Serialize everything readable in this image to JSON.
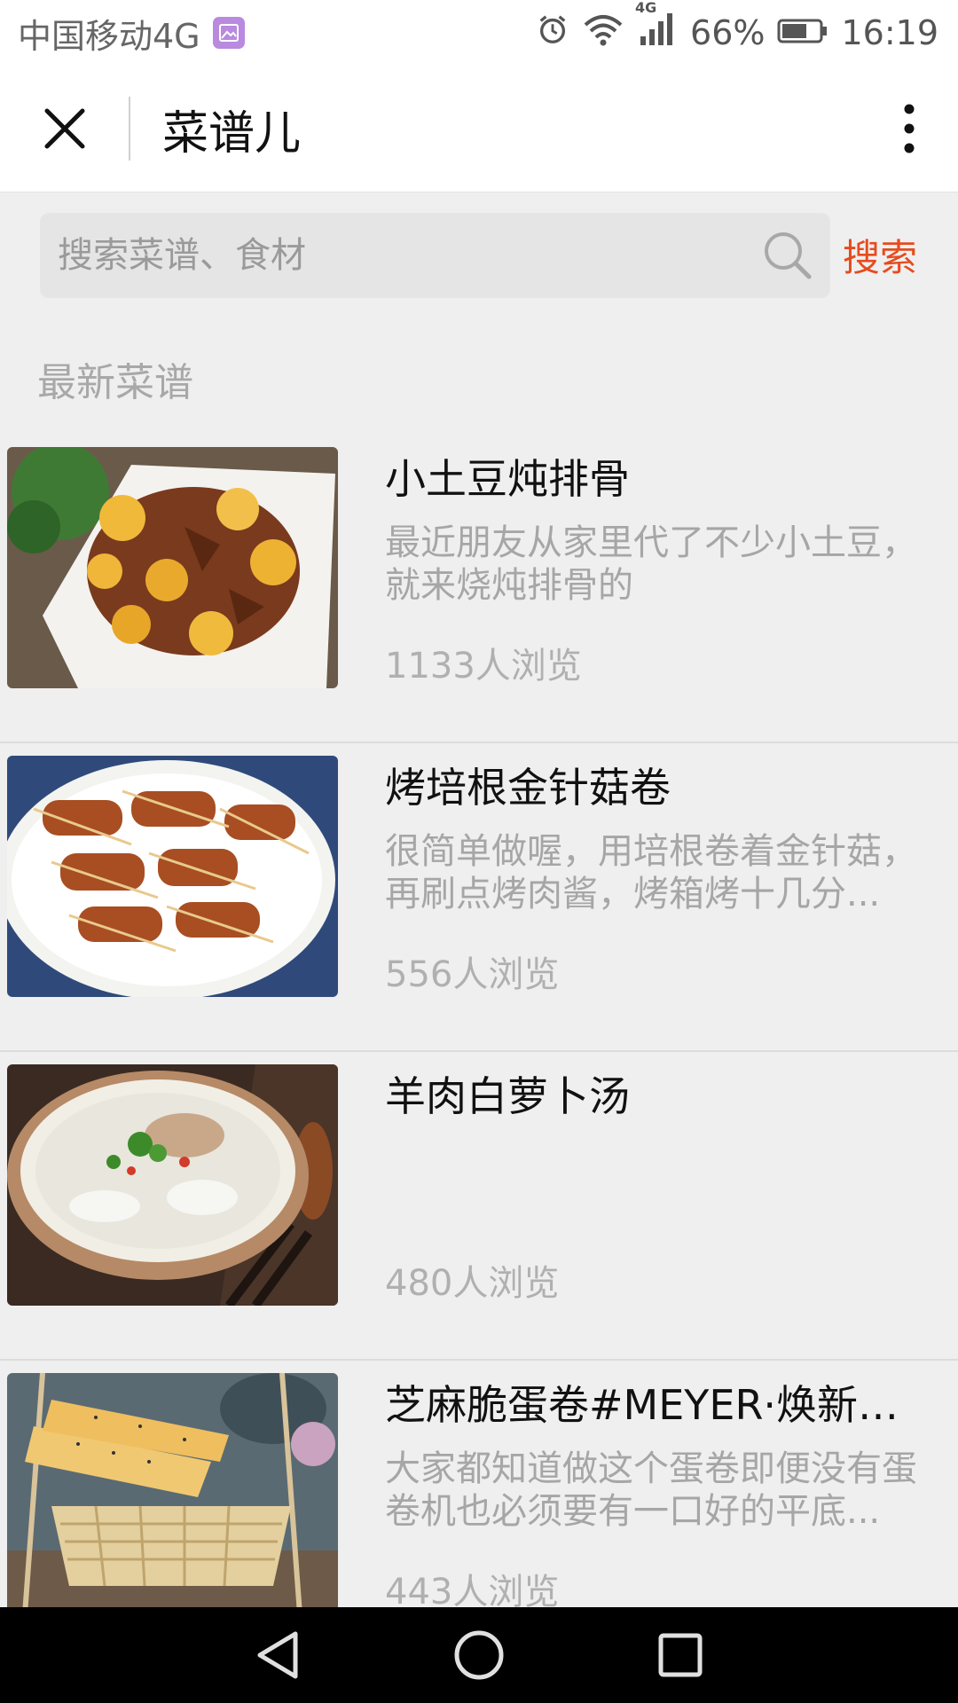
{
  "status_bar": {
    "carrier": "中国移动4G",
    "network_badge": "4G",
    "battery_pct": "66%",
    "time": "16:19",
    "icons": [
      "picture-icon",
      "alarm-icon",
      "wifi-icon",
      "signal-icon",
      "battery-icon"
    ]
  },
  "header": {
    "title": "菜谱儿",
    "icons": [
      "close-icon",
      "more-vertical-icon"
    ]
  },
  "search": {
    "placeholder": "搜索菜谱、食材",
    "button_label": "搜索",
    "icon": "search-icon",
    "accent_color": "#e64b1e"
  },
  "section": {
    "title": "最新菜谱"
  },
  "recipes": [
    {
      "title": "小土豆炖排骨",
      "desc": "最近朋友从家里代了不少小土豆，就来烧炖排骨的",
      "views": "1133人浏览"
    },
    {
      "title": "烤培根金针菇卷",
      "desc": "很简单做喔，用培根卷着金针菇，再刷点烤肉酱，烤箱烤十几分...",
      "views": "556人浏览"
    },
    {
      "title": "羊肉白萝卜汤",
      "desc": "",
      "views": "480人浏览"
    },
    {
      "title": "芝麻脆蛋卷#MEYER·焕新厨房...",
      "desc": "大家都知道做这个蛋卷即便没有蛋卷机也必须要有一口好的平底...",
      "views": "443人浏览"
    }
  ],
  "nav_bar": {
    "icons": [
      "back-triangle-icon",
      "home-circle-icon",
      "recents-square-icon"
    ]
  }
}
